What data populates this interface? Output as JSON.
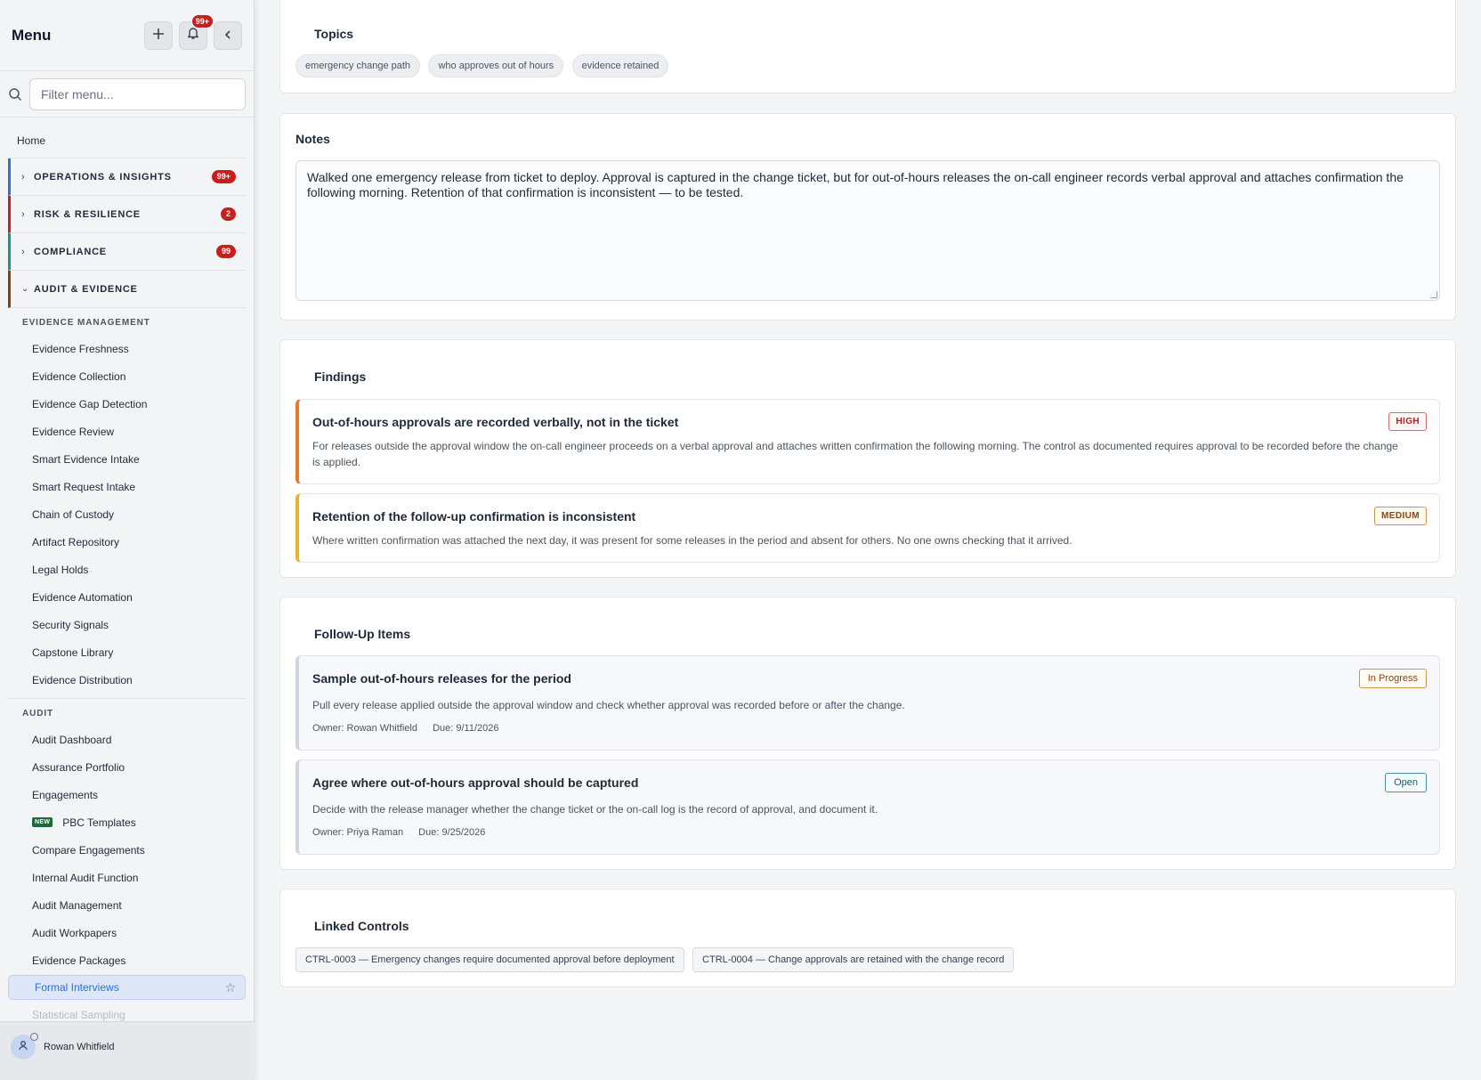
{
  "sidebar": {
    "title": "Menu",
    "notifications_badge": "99+",
    "search": {
      "placeholder": "Filter menu..."
    },
    "home": "Home",
    "groups": [
      {
        "label": "OPERATIONS & INSIGHTS",
        "count": "99+",
        "color": "#2f6fd6"
      },
      {
        "label": "RISK & RESILIENCE",
        "count": "2",
        "color": "#c81e1e"
      },
      {
        "label": "COMPLIANCE",
        "count": "99",
        "color": "#0f9a82"
      },
      {
        "label": "AUDIT & EVIDENCE",
        "count": "",
        "color": "#8a3a16"
      }
    ],
    "evidence_header": "EVIDENCE MANAGEMENT",
    "evidence_items": [
      "Evidence Freshness",
      "Evidence Collection",
      "Evidence Gap Detection",
      "Evidence Review",
      "Smart Evidence Intake",
      "Smart Request Intake",
      "Chain of Custody",
      "Artifact Repository",
      "Legal Holds",
      "Evidence Automation",
      "Security Signals",
      "Capstone Library",
      "Evidence Distribution"
    ],
    "audit_header": "AUDIT",
    "audit_items": [
      "Audit Dashboard",
      "Assurance Portfolio",
      "Engagements",
      "PBC Templates",
      "Compare Engagements",
      "Internal Audit Function",
      "Audit Management",
      "Audit Workpapers",
      "Evidence Packages",
      "Formal Interviews",
      "Statistical Sampling"
    ],
    "new_tag": "NEW",
    "user_name": "Rowan Whitfield"
  },
  "topics": {
    "title": "Topics",
    "chips": [
      "emergency change path",
      "who approves out of hours",
      "evidence retained"
    ]
  },
  "notes": {
    "title": "Notes",
    "text": "Walked one emergency release from ticket to deploy. Approval is captured in the change ticket, but for out-of-hours releases the on-call engineer records verbal approval and attaches confirmation the following morning. Retention of that confirmation is inconsistent — to be tested."
  },
  "findings": {
    "title": "Findings",
    "items": [
      {
        "title": "Out-of-hours approvals are recorded verbally, not in the ticket",
        "description": "For releases outside the approval window the on-call engineer proceeds on a verbal approval and attaches written confirmation the following morning. The control as documented requires approval to be recorded before the change is applied.",
        "severity": "HIGH",
        "color": "#ea7a2c"
      },
      {
        "title": "Retention of the follow-up confirmation is inconsistent",
        "description": "Where written confirmation was attached the next day, it was present for some releases in the period and absent for others. No one owns checking that it arrived.",
        "severity": "MEDIUM",
        "color": "#e8b52a"
      }
    ]
  },
  "followups": {
    "title": "Follow-Up Items",
    "items": [
      {
        "title": "Sample out-of-hours releases for the period",
        "description": "Pull every release applied outside the approval window and check whether approval was recorded before or after the change.",
        "owner": "Owner: Rowan Whitfield",
        "due": "Due: 9/11/2026",
        "status": "In Progress"
      },
      {
        "title": "Agree where out-of-hours approval should be captured",
        "description": "Decide with the release manager whether the change ticket or the on-call log is the record of approval, and document it.",
        "owner": "Owner: Priya Raman",
        "due": "Due: 9/25/2026",
        "status": "Open"
      }
    ]
  },
  "linked_controls": {
    "title": "Linked Controls",
    "items": [
      "CTRL-0003 — Emergency changes require documented approval before deployment",
      "CTRL-0004 — Change approvals are retained with the change record"
    ]
  }
}
